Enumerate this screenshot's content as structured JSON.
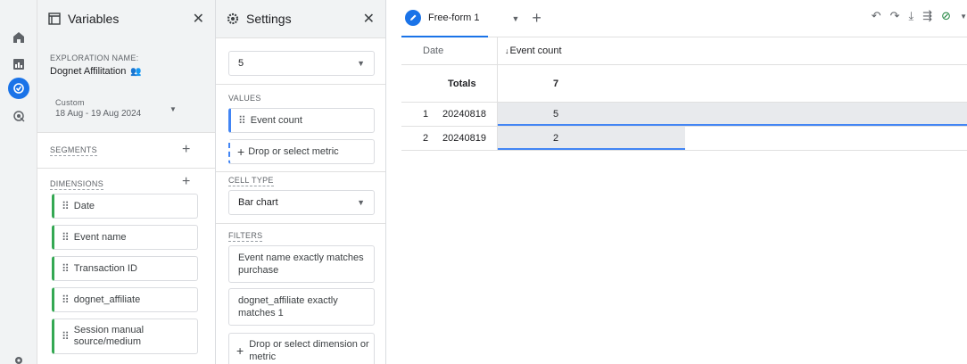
{
  "variables": {
    "title": "Variables",
    "exploration_name_label": "EXPLORATION NAME:",
    "exploration_name": "Dognet Affilitation",
    "date_preset": "Custom",
    "date_range": "18 Aug - 19 Aug 2024",
    "segments_label": "SEGMENTS",
    "dimensions_label": "DIMENSIONS",
    "dimensions": [
      "Date",
      "Event name",
      "Transaction ID",
      "dognet_affiliate",
      "Session manual source/medium"
    ]
  },
  "settings": {
    "title": "Settings",
    "rows_value": "5",
    "values_label": "VALUES",
    "metric": "Event count",
    "drop_metric": "Drop or select metric",
    "cell_type_label": "CELL TYPE",
    "cell_type": "Bar chart",
    "filters_label": "FILTERS",
    "filters": [
      "Event name exactly matches purchase",
      "dognet_affiliate exactly matches 1"
    ],
    "drop_filter": "Drop or select dimension or metric"
  },
  "tab": {
    "label": "Free-form 1"
  },
  "table": {
    "dim_header": "Date",
    "metric_header": "Event count",
    "sort_arrow": "↓",
    "totals_label": "Totals",
    "totals_value": "7",
    "rows": [
      {
        "num": "1",
        "date": "20240818",
        "value": "5"
      },
      {
        "num": "2",
        "date": "20240819",
        "value": "2"
      }
    ]
  },
  "chart_data": {
    "type": "bar",
    "categories": [
      "20240818",
      "20240819"
    ],
    "values": [
      5,
      2
    ]
  },
  "colors": {
    "accent": "#1a73e8",
    "dimension": "#34a853",
    "metric": "#4285f4",
    "bar": "#e8eaed"
  }
}
